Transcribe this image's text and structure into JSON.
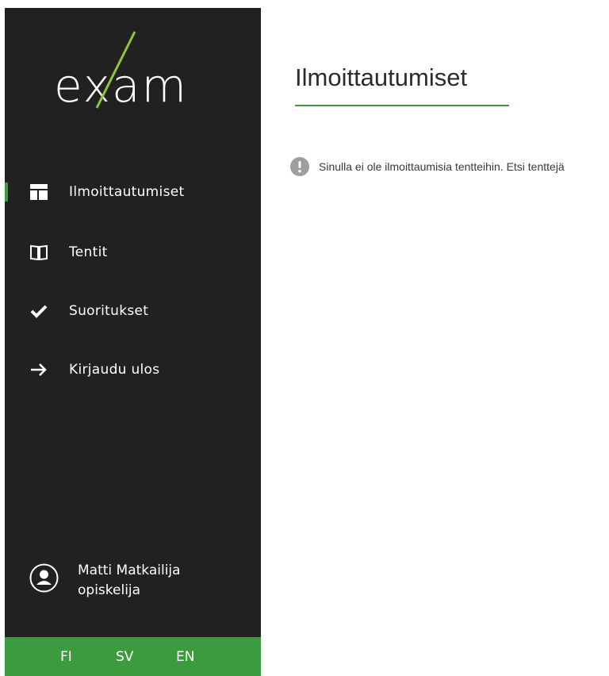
{
  "app": {
    "logo_text": "exam"
  },
  "sidebar": {
    "items": [
      {
        "label": "Ilmoittautumiset",
        "icon": "dashboard-icon",
        "active": true
      },
      {
        "label": "Tentit",
        "icon": "book-icon",
        "active": false
      },
      {
        "label": "Suoritukset",
        "icon": "checkmark-icon",
        "active": false
      },
      {
        "label": "Kirjaudu ulos",
        "icon": "arrow-right-icon",
        "active": false
      }
    ],
    "user": {
      "name": "Matti Matkailija",
      "role": "opiskelija",
      "icon": "user-avatar-icon"
    },
    "languages": [
      "FI",
      "SV",
      "EN"
    ]
  },
  "main": {
    "title": "Ilmoittautumiset",
    "notice": {
      "icon": "exclamation-icon",
      "text": "Sinulla ei ole ilmoittaumisia tentteihin. Etsi tenttejä"
    }
  },
  "colors": {
    "sidebar_bg": "#212121",
    "accent_green": "#3c9b3f",
    "logo_green": "#8cc63e"
  }
}
